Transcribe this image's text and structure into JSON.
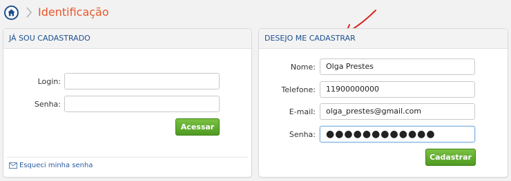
{
  "breadcrumb": {
    "current": "Identificação"
  },
  "login_panel": {
    "title": "JÁ SOU CADASTRADO",
    "login_label": "Login:",
    "login_value": "",
    "password_label": "Senha:",
    "password_value": "",
    "submit_label": "Acessar",
    "forgot_label": "Esqueci minha senha"
  },
  "register_panel": {
    "title": "DESEJO ME CADASTRAR",
    "name_label": "Nome:",
    "name_value": "Olga Prestes",
    "phone_label": "Telefone:",
    "phone_value": "11900000000",
    "email_label": "E-mail:",
    "email_value": "olga_prestes@gmail.com",
    "password_label": "Senha:",
    "password_value": "●●●●●●●●●●●●",
    "submit_label": "Cadastrar"
  },
  "colors": {
    "accent_orange": "#e8562a",
    "header_blue": "#1c4f8e",
    "button_green": "#5fa82e",
    "annotation_red": "#d9251d"
  }
}
